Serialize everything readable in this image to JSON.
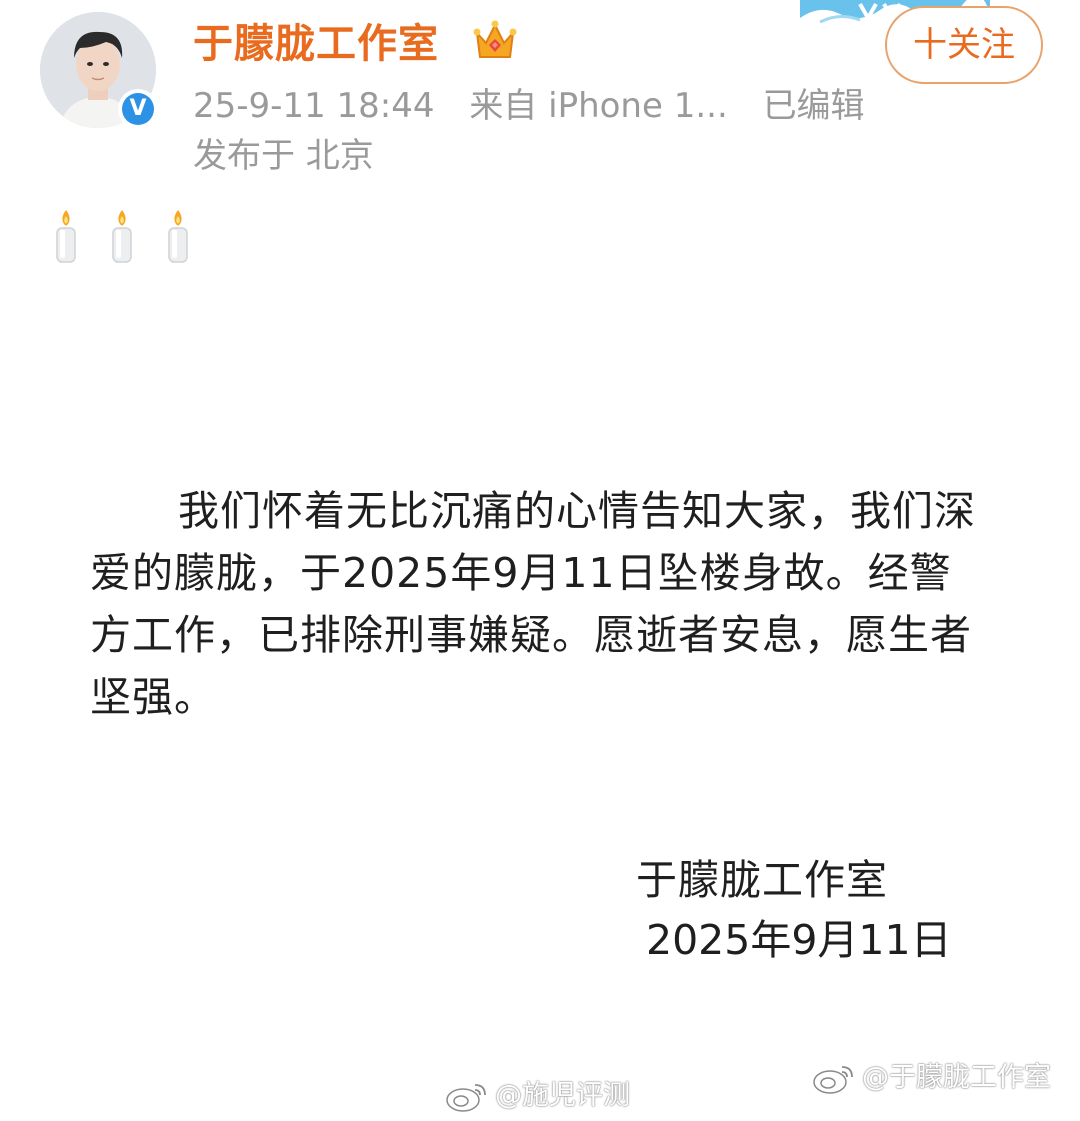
{
  "header": {
    "username": "于朦胧工作室",
    "badge_icon": "crown-icon",
    "verified_icon": "verified-v-icon",
    "verified_symbol": "V",
    "follow_label": "十关注",
    "timestamp": "25-9-11 18:44",
    "source": "来自 iPhone 1...",
    "edited": "已编辑",
    "location": "发布于 北京"
  },
  "post": {
    "emojis": [
      "candle-icon",
      "candle-icon",
      "candle-icon"
    ],
    "body": "我们怀着无比沉痛的心情告知大家，我们深爱的朦胧，于2025年9月11日坠楼身故。经警方工作，已排除刑事嫌疑。愿逝者安息，愿生者坚强。",
    "signature_name": "于朦胧工作室",
    "signature_date": "2025年9月11日"
  },
  "watermarks": {
    "right": "@于朦胧工作室",
    "left": "@施児评测"
  },
  "colors": {
    "username": "#e86b1f",
    "follow_border": "#e8a36d",
    "meta_text": "#9a9a9a",
    "verified": "#2d91e6",
    "body_text": "#1f1f1f"
  }
}
